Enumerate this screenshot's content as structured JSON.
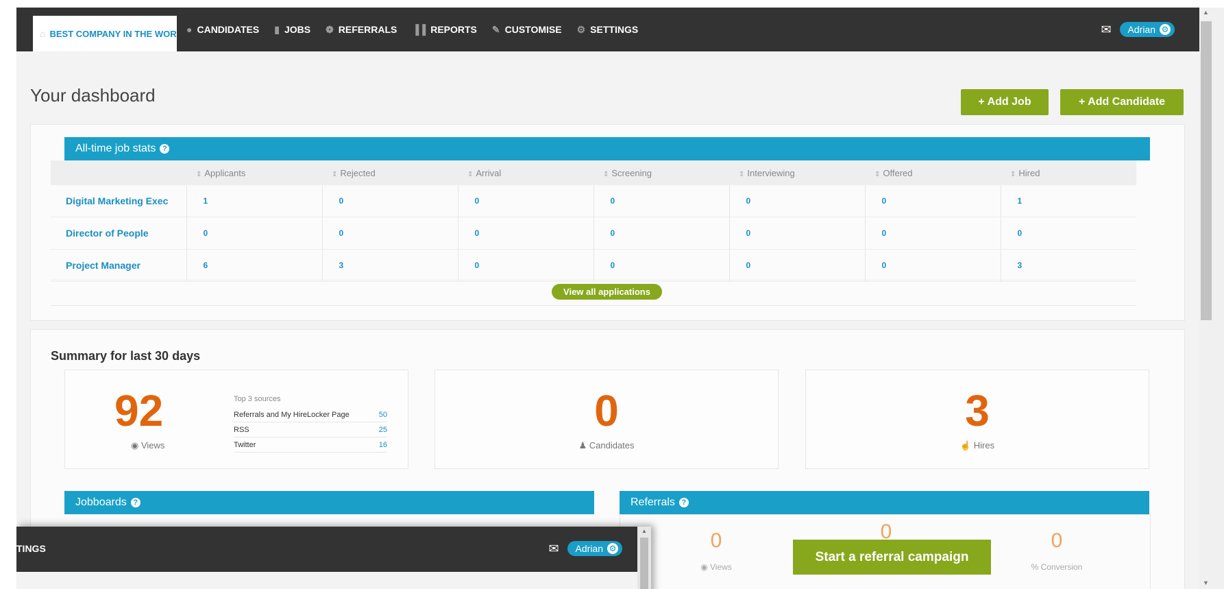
{
  "nav": {
    "home_label": "BEST COMPANY IN THE WORLD",
    "items": [
      {
        "label": "CANDIDATES",
        "icon": "person-icon"
      },
      {
        "label": "JOBS",
        "icon": "document-icon"
      },
      {
        "label": "REFERRALS",
        "icon": "badge-icon"
      },
      {
        "label": "REPORTS",
        "icon": "bar-chart-icon"
      },
      {
        "label": "CUSTOMISE",
        "icon": "pencil-icon"
      },
      {
        "label": "SETTINGS",
        "icon": "gear-icon"
      }
    ],
    "user_name": "Adrian"
  },
  "dashboard": {
    "title": "Your dashboard",
    "add_job_label": "+ Add Job",
    "add_candidate_label": "+ Add Candidate"
  },
  "job_stats": {
    "title": "All-time job stats",
    "columns": [
      "Applicants",
      "Rejected",
      "Arrival",
      "Screening",
      "Interviewing",
      "Offered",
      "Hired"
    ],
    "rows": [
      {
        "name": "Digital Marketing Exec",
        "values": [
          "1",
          "0",
          "0",
          "0",
          "0",
          "0",
          "1"
        ]
      },
      {
        "name": "Director of People",
        "values": [
          "0",
          "0",
          "0",
          "0",
          "0",
          "0",
          "0"
        ]
      },
      {
        "name": "Project Manager",
        "values": [
          "6",
          "3",
          "0",
          "0",
          "0",
          "0",
          "3"
        ]
      }
    ],
    "view_all_label": "View all applications"
  },
  "summary": {
    "title": "Summary for last 30 days",
    "views": {
      "value": "92",
      "label": "Views"
    },
    "sources": {
      "heading": "Top 3 sources",
      "rows": [
        {
          "name": "Referrals and My HireLocker Page",
          "value": "50"
        },
        {
          "name": "RSS",
          "value": "25"
        },
        {
          "name": "Twitter",
          "value": "16"
        }
      ]
    },
    "candidates": {
      "value": "0",
      "label": "Candidates"
    },
    "hires": {
      "value": "3",
      "label": "Hires"
    }
  },
  "jobboards": {
    "title": "Jobboards"
  },
  "referrals": {
    "title": "Referrals",
    "views_value": "0",
    "views_label": "Views",
    "middle_value": "0",
    "conversion_value": "0",
    "conversion_label": "% Conversion",
    "cta_label": "Start a referral campaign"
  },
  "overlay": {
    "settings_truncated": "TINGS",
    "user_name": "Adrian"
  },
  "colors": {
    "nav_bg": "#333333",
    "accent_blue": "#1aa0c8",
    "accent_green": "#87a81d",
    "stat_orange": "#e1650e"
  }
}
